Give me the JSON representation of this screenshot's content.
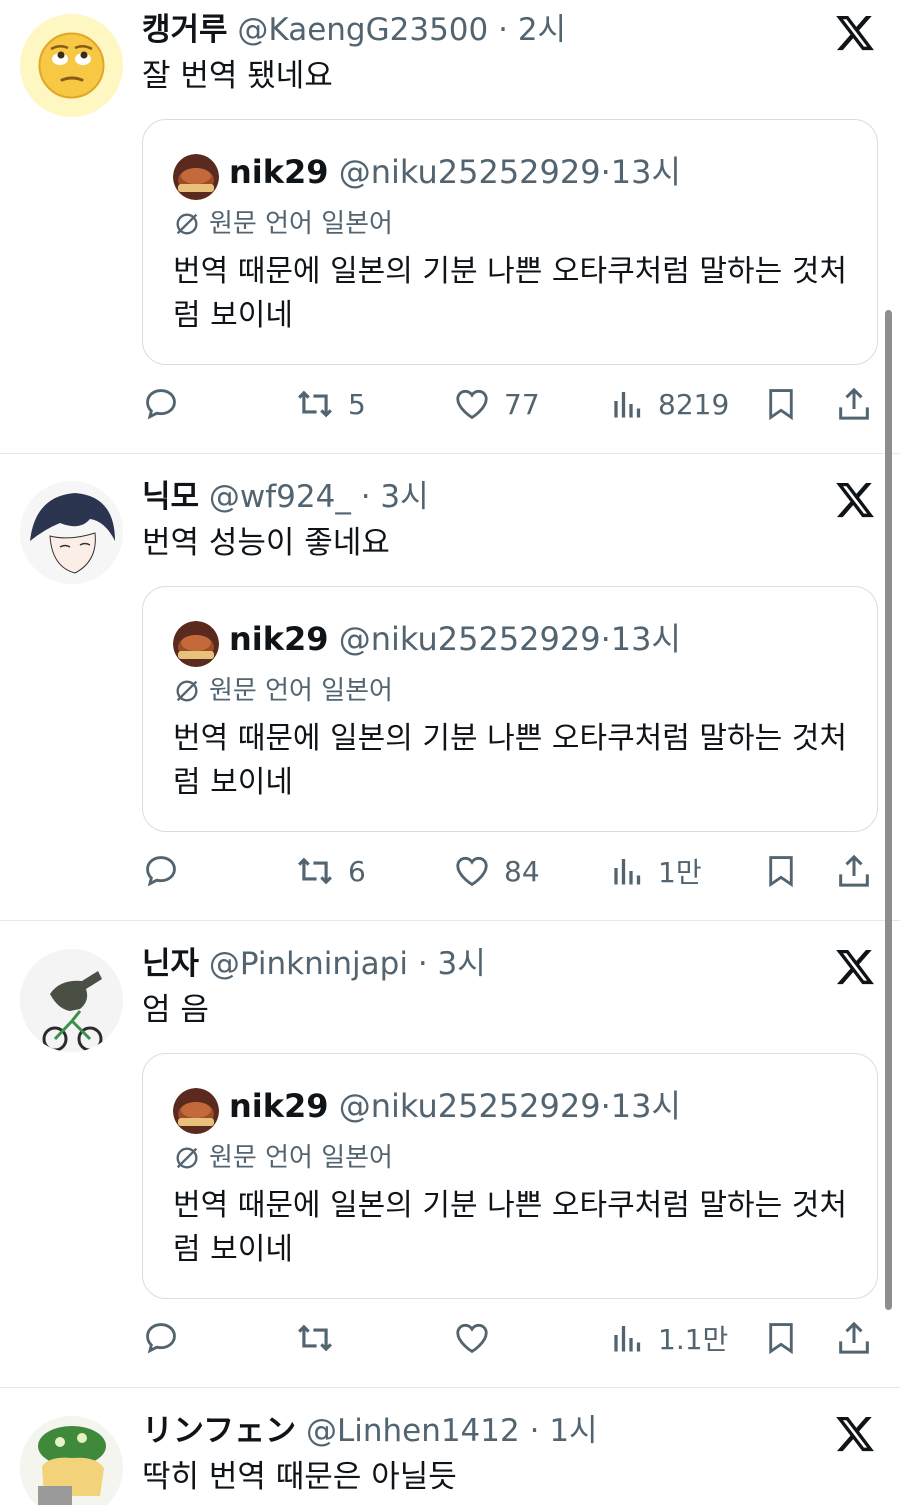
{
  "quoted": {
    "name": "nik29",
    "handle": "@niku25252929",
    "time": "13시",
    "lang_note": "원문 언어 일본어",
    "text": "번역 때문에 일본의 기분 나쁜 오타쿠처럼 말하는 것처럼 보이네"
  },
  "replies": [
    {
      "name": "캥거루",
      "handle": "@KaengG23500",
      "sep": "·",
      "time": "2시",
      "text": "잘 번역 됐네요",
      "retweets": "5",
      "likes": "77",
      "views": "8219"
    },
    {
      "name": "닉모",
      "handle": "@wf924_",
      "sep": "·",
      "time": "3시",
      "text": "번역 성능이  좋네요",
      "retweets": "6",
      "likes": "84",
      "views": "1만"
    },
    {
      "name": "닌자",
      "handle": "@Pinkninjapi",
      "sep": "·",
      "time": "3시",
      "text": "엄 음",
      "retweets": "",
      "likes": "",
      "views": "1.1만"
    },
    {
      "name": "リンフェン",
      "handle": "@Linhen1412",
      "sep": "·",
      "time": "1시",
      "text": "딱히 번역 때문은 아닐듯"
    }
  ],
  "icons": {
    "platform": "x-logo-icon",
    "reply": "reply-icon",
    "retweet": "retweet-icon",
    "like": "heart-icon",
    "views": "views-icon",
    "bookmark": "bookmark-icon",
    "share": "share-icon",
    "translate": "translate-icon"
  },
  "colors": {
    "text": "#0f1419",
    "secondary": "#536471",
    "border": "#d8dde1"
  }
}
